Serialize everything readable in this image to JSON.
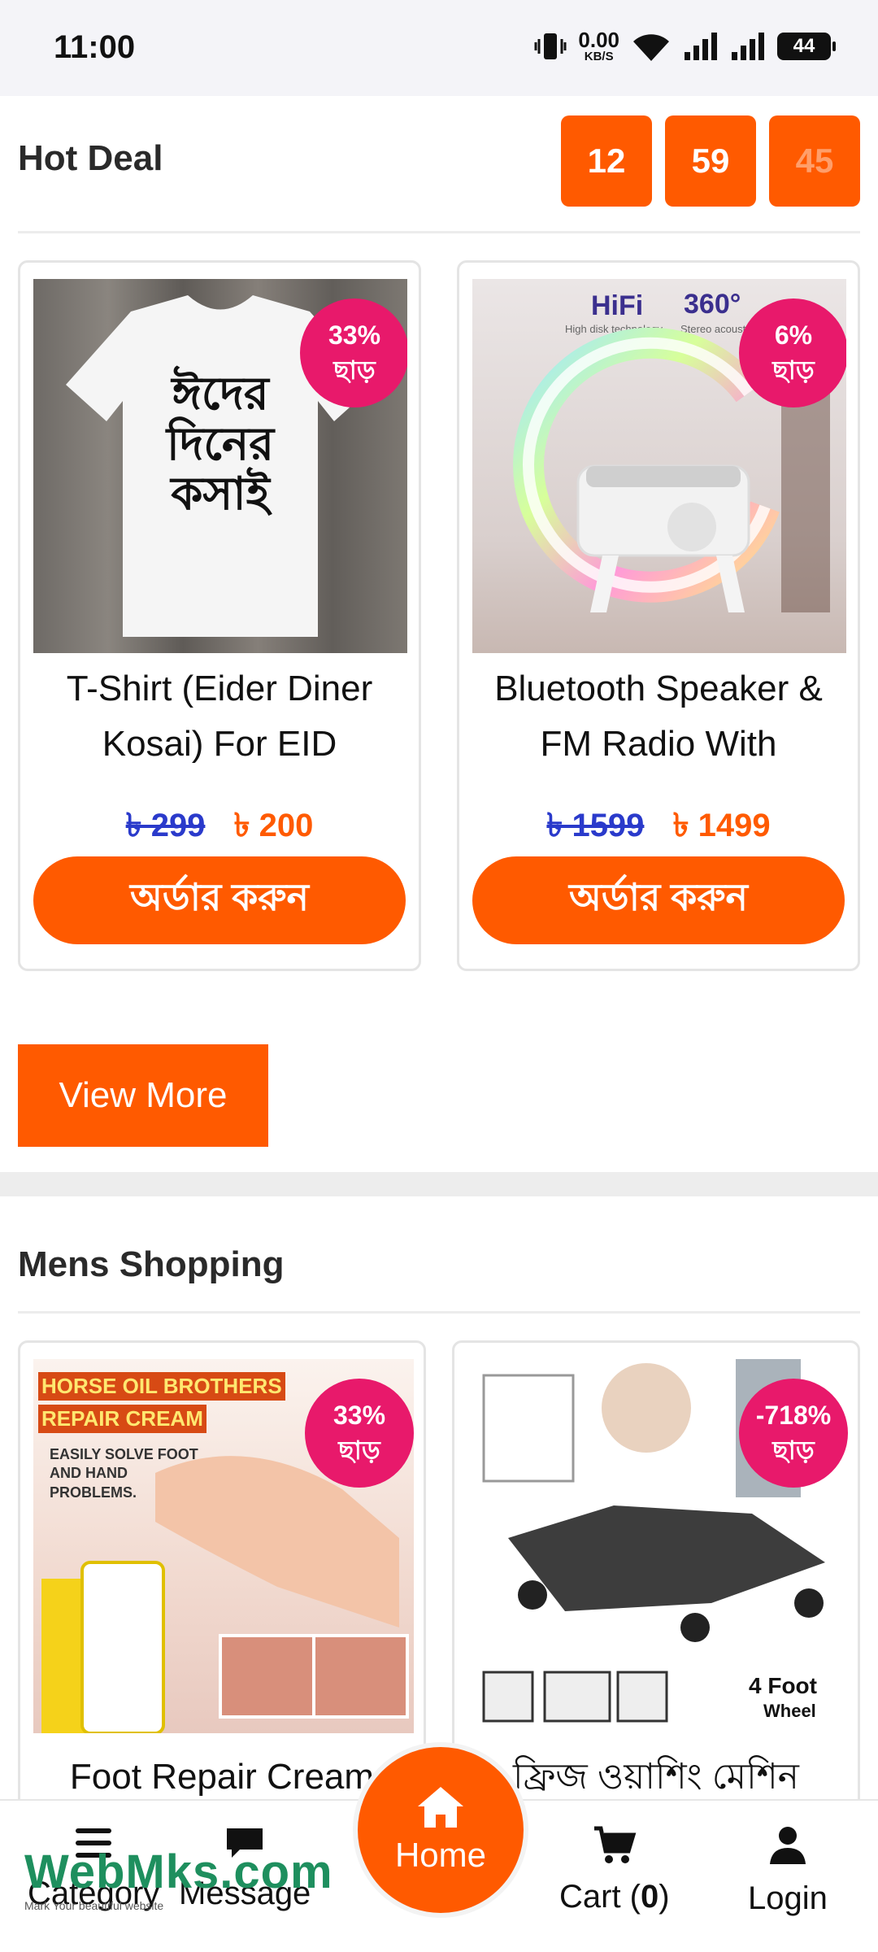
{
  "status_bar": {
    "time": "11:00",
    "speed_value": "0.00",
    "speed_unit": "KB/S",
    "battery": "44"
  },
  "hot_deal": {
    "title": "Hot Deal",
    "timer": [
      "12",
      "59",
      "45"
    ],
    "products": [
      {
        "name_line1": "T-Shirt (Eider Diner",
        "name_line2": "Kosai) For EID",
        "old_price": "৳ 299",
        "new_price": "৳ 200",
        "badge_percent": "33%",
        "badge_label": "ছাড়",
        "order_label": "অর্ডার করুন",
        "image_text": "ঈদের দিনের কসাই"
      },
      {
        "name_line1": "Bluetooth Speaker &",
        "name_line2": "FM Radio With",
        "old_price": "৳ 1599",
        "new_price": "৳ 1499",
        "badge_percent": "6%",
        "badge_label": "ছাড়",
        "order_label": "অর্ডার করুন",
        "image_text_1": "HiFi",
        "image_text_2": "360°",
        "image_text_3": "High disk technology",
        "image_text_4": "Stereo acoust"
      }
    ],
    "view_more": "View More"
  },
  "mens_shopping": {
    "title": "Mens Shopping",
    "products": [
      {
        "name": "Foot Repair Cream",
        "badge_percent": "33%",
        "badge_label": "ছাড়",
        "image_text_1": "HORSE OIL BROTHERS",
        "image_text_2": "REPAIR CREAM",
        "image_text_3": "EASILY SOLVE FOOT AND HAND PROBLEMS."
      },
      {
        "name": "ফ্রিজ ওয়াশিং মেশিন",
        "badge_percent": "-718%",
        "badge_label": "ছাড়",
        "image_text_1": "4 Foot",
        "image_text_2": "Wheel"
      }
    ]
  },
  "bottom_nav": {
    "category": "Category",
    "message": "Message",
    "home": "Home",
    "cart_label": "Cart (",
    "cart_count": "0",
    "cart_close": ")",
    "login": "Login"
  },
  "watermark": {
    "brand": "WebMks.com",
    "tagline": "Mark Your beautiful website"
  },
  "colors": {
    "accent": "#ff5a00",
    "badge": "#e8196b",
    "old_price": "#2a3acb"
  }
}
